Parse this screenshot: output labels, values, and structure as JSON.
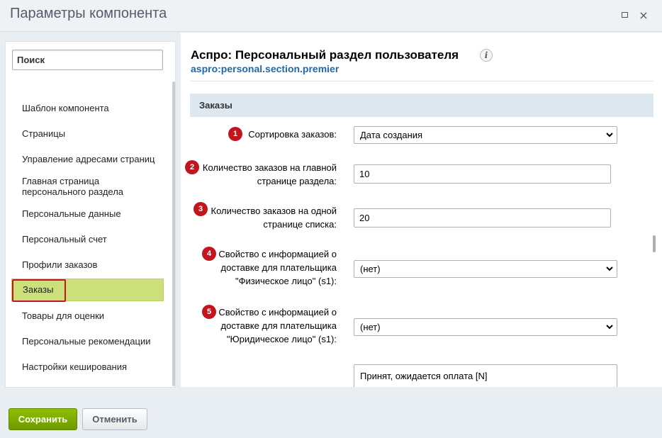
{
  "window": {
    "title": "Параметры компонента",
    "maximize_icon": "maximize-icon",
    "close_symbol": "×"
  },
  "sidebar": {
    "search_placeholder": "Поиск",
    "items": [
      {
        "label": "Шаблон компонента"
      },
      {
        "label": "Страницы"
      },
      {
        "label": "Управление адресами страниц"
      },
      {
        "label": "Главная страница персонального раздела"
      },
      {
        "label": "Персональные данные"
      },
      {
        "label": "Персональный счет"
      },
      {
        "label": "Профили заказов"
      },
      {
        "label": "Заказы",
        "active": true
      },
      {
        "label": "Товары для оценки"
      },
      {
        "label": "Персональные рекомендации"
      },
      {
        "label": "Настройки кеширования"
      }
    ]
  },
  "component": {
    "title": "Аспро: Персональный раздел пользователя",
    "info_symbol": "i",
    "code": "aspro:personal.section.premier"
  },
  "section": {
    "title": "Заказы"
  },
  "fields": [
    {
      "badge": "1",
      "label": "Сортировка заказов:",
      "type": "select",
      "value": "Дата создания"
    },
    {
      "badge": "2",
      "label_lines": [
        "Количество заказов на главной",
        "странице раздела:"
      ],
      "type": "input",
      "value": "10"
    },
    {
      "badge": "3",
      "label_lines": [
        "Количество заказов на одной",
        "странице списка:"
      ],
      "type": "input",
      "value": "20"
    },
    {
      "badge": "4",
      "label_lines": [
        "Свойство с информацией о",
        "доставке для плательщика",
        "\"Физическое лицо\" (s1):"
      ],
      "type": "select",
      "value": "(нет)"
    },
    {
      "badge": "5",
      "label_lines": [
        "Свойство с информацией о",
        "доставке для плательщика",
        "\"Юридическое лицо\" (s1):"
      ],
      "type": "select",
      "value": "(нет)"
    }
  ],
  "status_list": {
    "first_option": "Принят, ожидается оплата [N]"
  },
  "footer": {
    "save_label": "Сохранить",
    "cancel_label": "Отменить"
  },
  "colors": {
    "active_item": "#cbe07a",
    "badge": "#c3151e",
    "save_button": "#7aa700",
    "code_link": "#2067b0"
  }
}
